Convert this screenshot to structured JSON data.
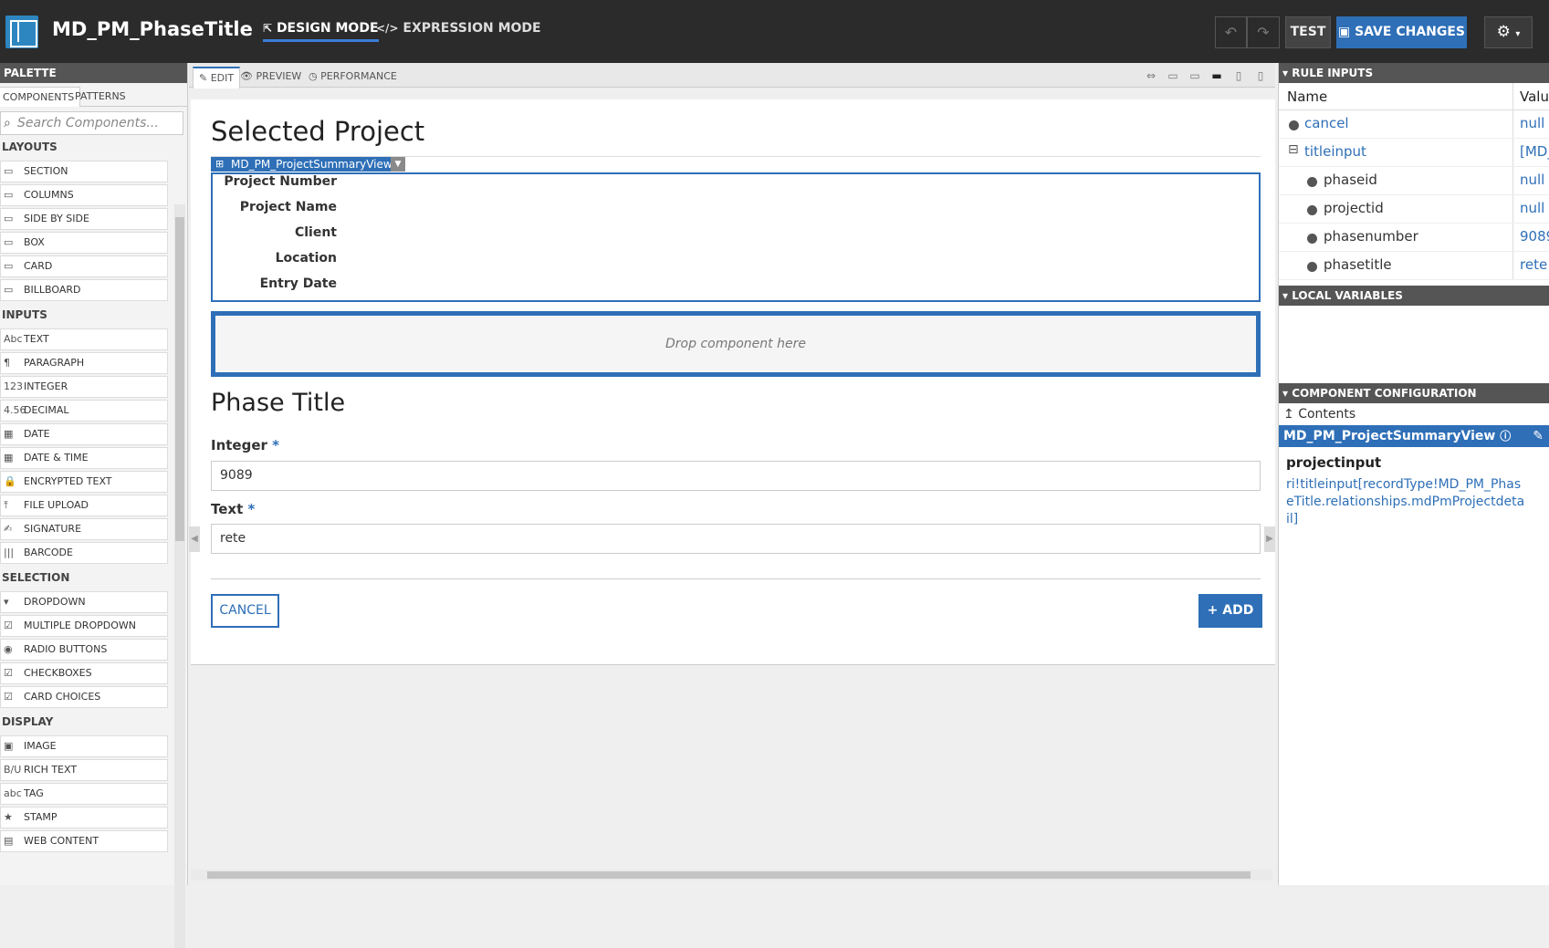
{
  "app": {
    "title": "MD_PM_PhaseTitle"
  },
  "modes": {
    "design": "DESIGN MODE",
    "expression": "EXPRESSION MODE"
  },
  "toolbar": {
    "test": "TEST",
    "save": "SAVE CHANGES"
  },
  "palette": {
    "title": "PALETTE",
    "tabs": [
      "COMPONENTS",
      "PATTERNS"
    ],
    "search_placeholder": "Search Components...",
    "categories": {
      "layouts": "LAYOUTS",
      "inputs": "INPUTS",
      "selection": "SELECTION",
      "display": "DISPLAY"
    },
    "layouts": [
      {
        "icon": "section-icon",
        "label": "SECTION"
      },
      {
        "icon": "columns-icon",
        "label": "COLUMNS"
      },
      {
        "icon": "side-by-side-icon",
        "label": "SIDE BY SIDE"
      },
      {
        "icon": "box-icon",
        "label": "BOX"
      },
      {
        "icon": "card-icon",
        "label": "CARD"
      },
      {
        "icon": "billboard-icon",
        "label": "BILLBOARD"
      }
    ],
    "inputs": [
      {
        "icon": "text-icon",
        "glyph": "Abc",
        "label": "TEXT"
      },
      {
        "icon": "paragraph-icon",
        "glyph": "¶",
        "label": "PARAGRAPH"
      },
      {
        "icon": "integer-icon",
        "glyph": "123",
        "label": "INTEGER"
      },
      {
        "icon": "decimal-icon",
        "glyph": "4.56",
        "label": "DECIMAL"
      },
      {
        "icon": "date-icon",
        "glyph": "▦",
        "label": "DATE"
      },
      {
        "icon": "date-time-icon",
        "glyph": "▦",
        "label": "DATE & TIME"
      },
      {
        "icon": "lock-icon",
        "glyph": "🔒",
        "label": "ENCRYPTED TEXT"
      },
      {
        "icon": "upload-icon",
        "glyph": "⤒",
        "label": "FILE UPLOAD"
      },
      {
        "icon": "signature-icon",
        "glyph": "✍",
        "label": "SIGNATURE"
      },
      {
        "icon": "barcode-icon",
        "glyph": "|||",
        "label": "BARCODE"
      }
    ],
    "selection": [
      {
        "icon": "dropdown-icon",
        "glyph": "▾",
        "label": "DROPDOWN"
      },
      {
        "icon": "multiple-dropdown-icon",
        "glyph": "☑",
        "label": "MULTIPLE DROPDOWN"
      },
      {
        "icon": "radio-icon",
        "glyph": "◉",
        "label": "RADIO BUTTONS"
      },
      {
        "icon": "checkbox-icon",
        "glyph": "☑",
        "label": "CHECKBOXES"
      },
      {
        "icon": "card-choices-icon",
        "glyph": "☑",
        "label": "CARD CHOICES"
      }
    ],
    "display": [
      {
        "icon": "image-icon",
        "glyph": "▣",
        "label": "IMAGE"
      },
      {
        "icon": "rich-text-icon",
        "glyph": "B/U",
        "label": "RICH TEXT"
      },
      {
        "icon": "tag-icon",
        "glyph": "abc",
        "label": "TAG"
      },
      {
        "icon": "stamp-icon",
        "glyph": "★",
        "label": "STAMP"
      },
      {
        "icon": "web-content-icon",
        "glyph": "▤",
        "label": "WEB CONTENT"
      }
    ]
  },
  "canvas": {
    "tabs": [
      "EDIT",
      "PREVIEW",
      "PERFORMANCE"
    ],
    "heading": "Selected Project",
    "component_name": "MD_PM_ProjectSummaryView",
    "summary_labels": [
      "Project Number",
      "Project Name",
      "Client",
      "Location",
      "Entry Date"
    ],
    "drop_text": "Drop component here",
    "section_title": "Phase Title",
    "integer_label": "Integer",
    "integer_value": "9089",
    "text_label": "Text",
    "text_value": "rete",
    "required_mark": "*",
    "cancel": "CANCEL",
    "add": "ADD"
  },
  "rule_inputs": {
    "title": "RULE INPUTS",
    "col_name": "Name",
    "col_value": "Valu",
    "rows": [
      {
        "name": "cancel",
        "value": "null"
      },
      {
        "name": "titleinput",
        "value": "[MD_"
      },
      {
        "name": "phaseid",
        "value": "null"
      },
      {
        "name": "projectid",
        "value": "null"
      },
      {
        "name": "phasenumber",
        "value": "9089"
      },
      {
        "name": "phasetitle",
        "value": "rete"
      }
    ]
  },
  "local_variables": {
    "title": "LOCAL VARIABLES"
  },
  "component_configuration": {
    "title": "COMPONENT CONFIGURATION",
    "contents": "Contents",
    "component": "MD_PM_ProjectSummaryView",
    "param_name": "projectinput",
    "param_value": "ri!titleinput[recordType!MD_PM_PhaseTitle.relationships.mdPmProjectdetail]"
  }
}
